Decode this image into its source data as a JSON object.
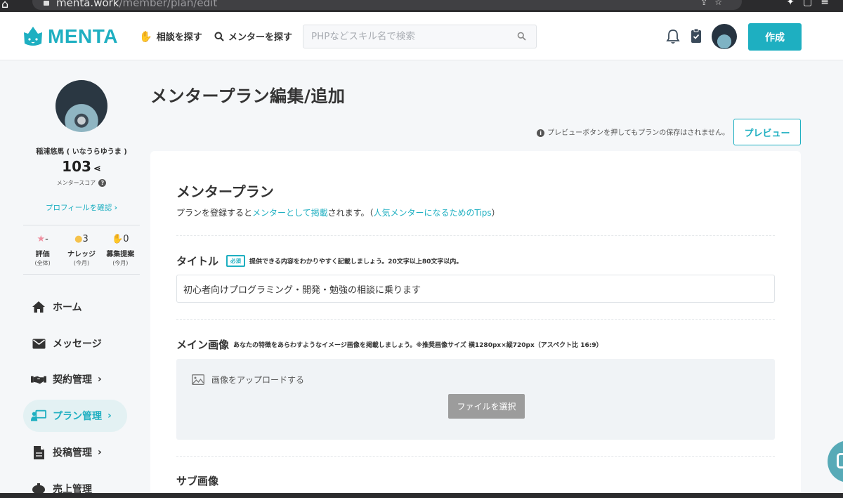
{
  "browser": {
    "url_host": "menta.work",
    "url_path": "/member/plan/edit"
  },
  "header": {
    "logo": "MENTA",
    "nav_consult": "相談を探す",
    "nav_mentor": "メンターを探す",
    "search_placeholder": "PHPなどスキル名で検索",
    "create_label": "作成"
  },
  "sidebar": {
    "name": "稲浦悠馬 ( いなうらゆうま )",
    "score": "103",
    "score_label": "メンタースコア",
    "profile_link": "プロフィールを確認",
    "stats": [
      {
        "value": "-",
        "label": "評価",
        "sub": "(全体)",
        "color": "#f08fa0"
      },
      {
        "value": "3",
        "label": "ナレッジ",
        "sub": "(今月)",
        "color": "#f5c24c"
      },
      {
        "value": "0",
        "label": "募集提案",
        "sub": "(今月)",
        "color": "#1eafc1"
      }
    ],
    "menu": [
      {
        "label": "ホーム",
        "icon": "home-icon"
      },
      {
        "label": "メッセージ",
        "icon": "envelope-icon"
      },
      {
        "label": "契約管理",
        "icon": "handshake-icon"
      },
      {
        "label": "プラン管理",
        "icon": "presentation-icon"
      },
      {
        "label": "投稿管理",
        "icon": "document-icon"
      },
      {
        "label": "売上管理",
        "icon": "piggy-bank-icon"
      }
    ]
  },
  "main": {
    "page_title": "メンタープラン編集/追加",
    "preview_note": "プレビューボタンを押してもプランの保存はされません。",
    "preview_label": "プレビュー",
    "card": {
      "title": "メンタープラン",
      "desc_before": "プランを登録すると",
      "desc_link1": "メンターとして掲載",
      "desc_middle": "されます。（",
      "desc_link2": "人気メンターになるためのTips",
      "desc_after": "）",
      "title_label": "タイトル",
      "required": "必須",
      "title_hint": "提供できる内容をわかりやすく記載しましょう。20文字以上80文字以内。",
      "title_value": "初心者向けプログラミング・開発・勉強の相談に乗ります",
      "image_label": "メイン画像",
      "image_hint": "あなたの特徴をあらわすようなイメージ画像を掲載しましょう。※推奨画像サイズ 横1280px×縦720px（アスペクト比 16:9）",
      "upload_label": "画像をアップロードする",
      "file_button": "ファイルを選択",
      "sub_image_label": "サブ画像"
    }
  },
  "colors": {
    "brand": "#1eafc1",
    "active_bg": "#e3f1f3"
  }
}
